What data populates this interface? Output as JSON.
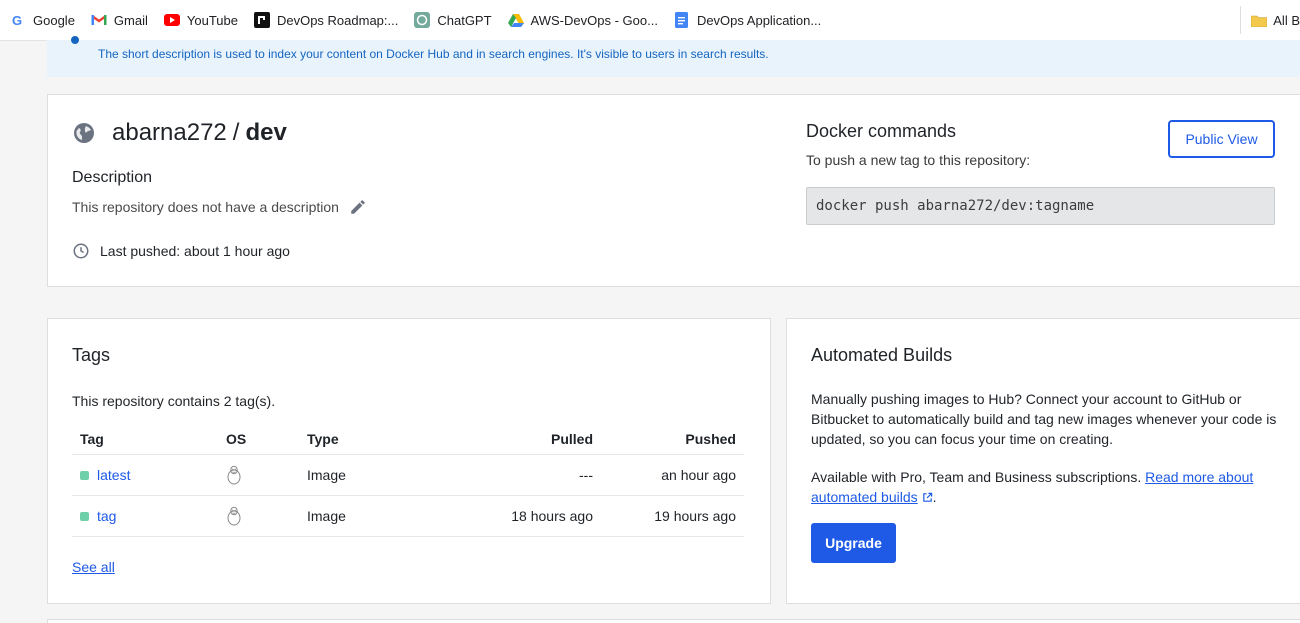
{
  "bookmarks": {
    "items": [
      {
        "label": "Google",
        "icon": "google-icon"
      },
      {
        "label": "Gmail",
        "icon": "gmail-icon"
      },
      {
        "label": "YouTube",
        "icon": "youtube-icon"
      },
      {
        "label": "DevOps Roadmap:...",
        "icon": "roadmap-icon"
      },
      {
        "label": "ChatGPT",
        "icon": "chatgpt-icon"
      },
      {
        "label": "AWS-DevOps - Goo...",
        "icon": "drive-icon"
      },
      {
        "label": "DevOps Application...",
        "icon": "docs-icon"
      }
    ],
    "all_bookmarks": "All B"
  },
  "banner": {
    "text": "The short description is used to index your content on Docker Hub and in search engines. It's visible to users in search results."
  },
  "repo": {
    "owner": "abarna272",
    "separator": "/",
    "name": "dev",
    "description_heading": "Description",
    "description_text": "This repository does not have a description",
    "last_pushed": "Last pushed: about 1 hour ago"
  },
  "docker_commands": {
    "heading": "Docker commands",
    "subtitle": "To push a new tag to this repository:",
    "command": "docker push abarna272/dev:tagname",
    "public_view_label": "Public View"
  },
  "tags": {
    "heading": "Tags",
    "count_text": "This repository contains 2 tag(s).",
    "columns": {
      "tag": "Tag",
      "os": "OS",
      "type": "Type",
      "pulled": "Pulled",
      "pushed": "Pushed"
    },
    "rows": [
      {
        "tag": "latest",
        "os": "linux-icon",
        "type": "Image",
        "pulled": "---",
        "pushed": "an hour ago"
      },
      {
        "tag": "tag",
        "os": "linux-icon",
        "type": "Image",
        "pulled": "18 hours ago",
        "pushed": "19 hours ago"
      }
    ],
    "see_all": "See all",
    "status_color": "#6fd0a8"
  },
  "automated_builds": {
    "heading": "Automated Builds",
    "paragraph1": "Manually pushing images to Hub? Connect your account to GitHub or Bitbucket to automatically build and tag new images whenever your code is updated, so you can focus your time on creating.",
    "paragraph2_prefix": "Available with Pro, Team and Business subscriptions. ",
    "read_more_link": "Read more about automated builds",
    "paragraph2_suffix": ".",
    "upgrade_label": "Upgrade"
  },
  "colors": {
    "accent": "#1e5ae6",
    "banner_bg": "#e8f3fc",
    "banner_text": "#1565c0"
  }
}
